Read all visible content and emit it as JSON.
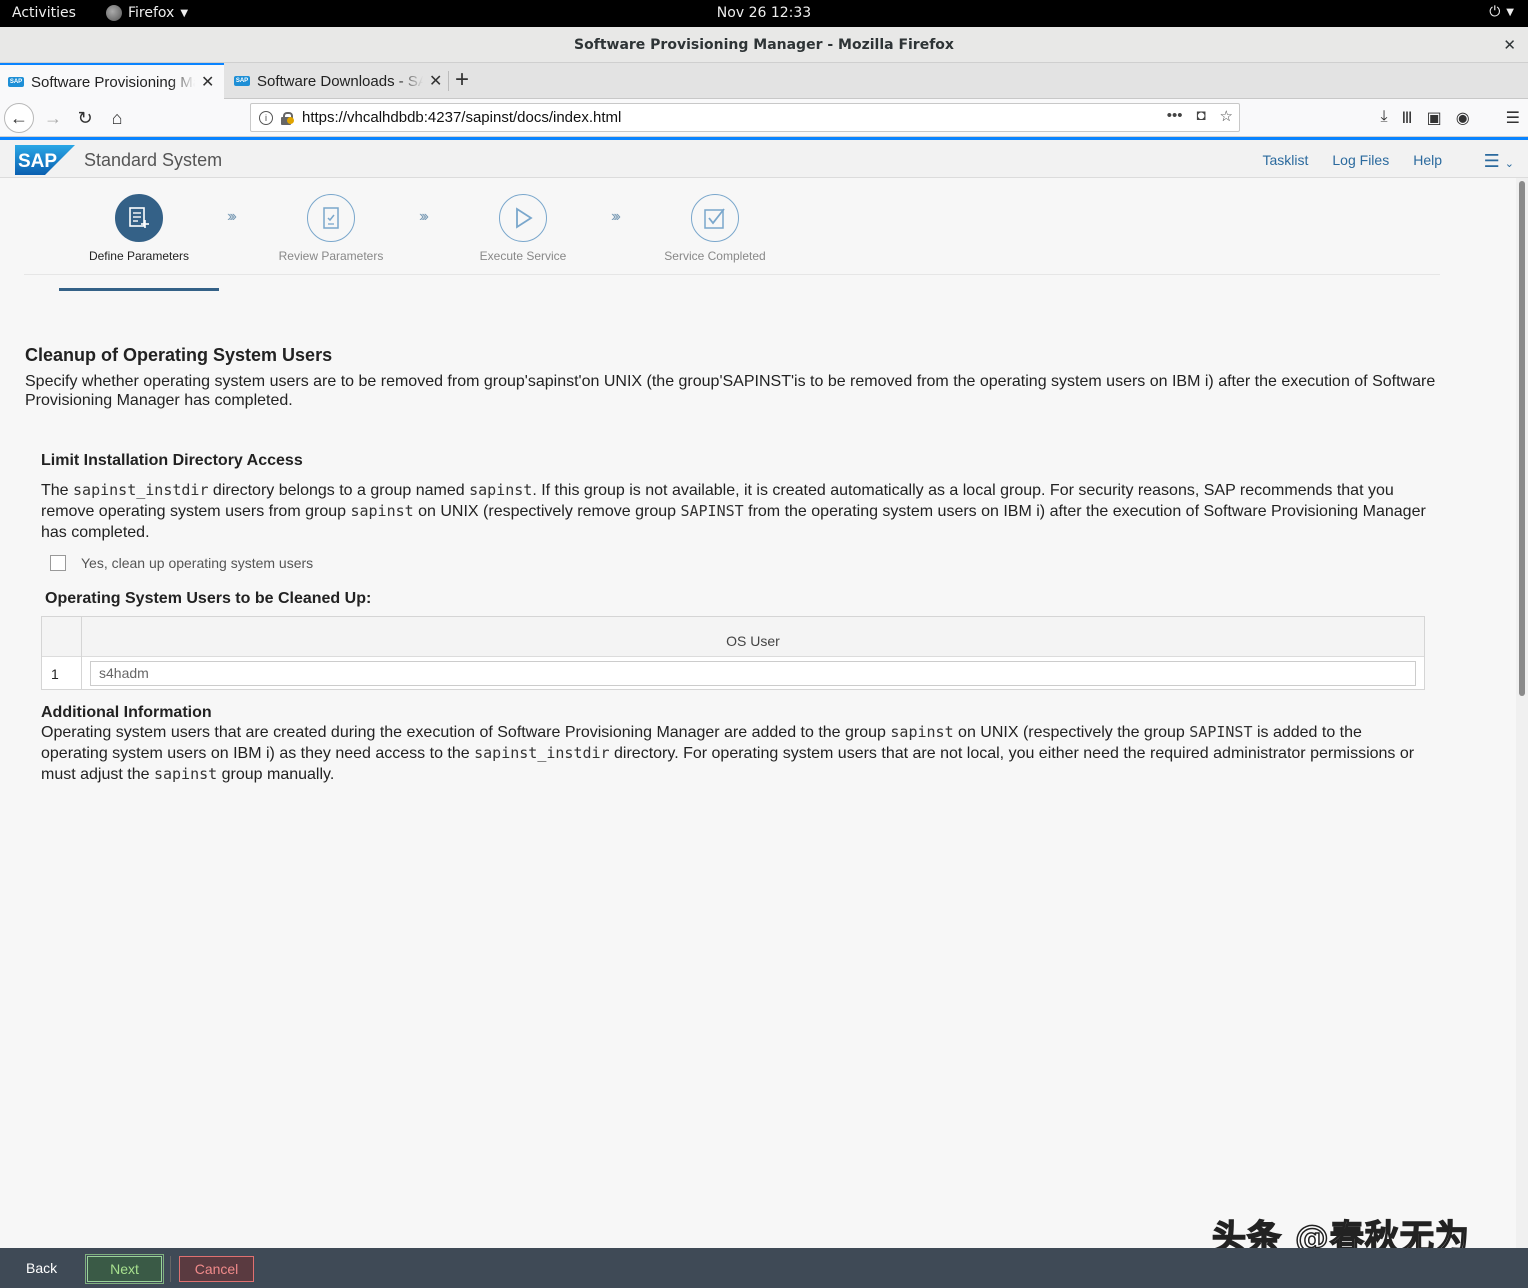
{
  "gnome": {
    "activities": "Activities",
    "app_name": "Firefox",
    "clock": "Nov 26  12:33"
  },
  "window": {
    "title": "Software Provisioning Manager - Mozilla Firefox"
  },
  "tabs": [
    {
      "title": "Software Provisioning Manager",
      "active": true
    },
    {
      "title": "Software Downloads - SAP ONE Support Launchpad",
      "active": false
    }
  ],
  "urlbar": {
    "url": "https://vhcalhdbdb:4237/sapinst/docs/index.html"
  },
  "sap_header": {
    "logo_text": "SAP",
    "app_title": "Standard System",
    "links": [
      "Tasklist",
      "Log Files",
      "Help"
    ]
  },
  "wizard": {
    "steps": [
      {
        "label": "Define Parameters",
        "active": true,
        "icon": "form-icon"
      },
      {
        "label": "Review Parameters",
        "active": false,
        "icon": "document-check-icon"
      },
      {
        "label": "Execute Service",
        "active": false,
        "icon": "play-icon"
      },
      {
        "label": "Service Completed",
        "active": false,
        "icon": "checkmark-icon"
      }
    ]
  },
  "page": {
    "title": "Cleanup of Operating System Users",
    "description": "Specify whether operating system users are to be removed from group'sapinst'on UNIX (the group'SAPINST'is to be removed from the operating system users on IBM i) after the execution of Software Provisioning Manager has completed."
  },
  "limit_section": {
    "heading": "Limit Installation Directory Access",
    "p1": "The ",
    "code1": "sapinst_instdir",
    "p2": " directory belongs to a group named ",
    "code2": "sapinst",
    "p3": ". If this group is not available, it is created automatically as a local group. For security reasons, SAP recommends that you remove operating system users from group ",
    "code3": "sapinst",
    "p4": " on UNIX (respectively remove group ",
    "code4": "SAPINST",
    "p5": " from the operating system users on IBM i) after the execution of Software Provisioning Manager has completed.",
    "checkbox_label": "Yes, clean up operating system users",
    "checkbox_checked": false
  },
  "users_table": {
    "title": "Operating System Users to be Cleaned Up:",
    "column": "OS User",
    "rows": [
      {
        "num": "1",
        "user": "s4hadm"
      }
    ]
  },
  "additional": {
    "heading": "Additional Information",
    "p1": "Operating system users that are created during the execution of Software Provisioning Manager are added to the group ",
    "code1": "sapinst",
    "p2": " on UNIX (respectively the group ",
    "code2": "SAPINST",
    "p3": " is added to the operating system users on IBM i) as they need access to the ",
    "code3": "sapinst_instdir",
    "p4": " directory. For operating system users that are not local, you either need the required administrator permissions or must adjust the ",
    "code4": "sapinst",
    "p5": " group manually."
  },
  "footer": {
    "back": "Back",
    "next": "Next",
    "cancel": "Cancel"
  },
  "watermark": "头条 @春秋无为",
  "colors": {
    "sap_blue": "#346187",
    "firefox_accent": "#0a84ff",
    "footer_bg": "#3f4a56"
  }
}
